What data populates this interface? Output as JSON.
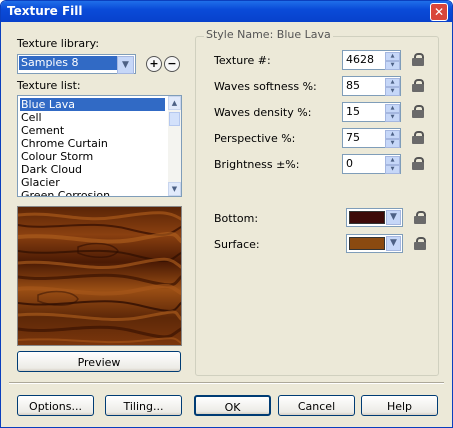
{
  "window": {
    "title": "Texture Fill",
    "close_glyph": "✕"
  },
  "library": {
    "label": "Texture library:",
    "selected": "Samples 8",
    "add_glyph": "+",
    "remove_glyph": "−"
  },
  "texture_list": {
    "label": "Texture list:",
    "items": [
      "Blue Lava",
      "Cell",
      "Cement",
      "Chrome Curtain",
      "Colour Storm",
      "Dark Cloud",
      "Glacier",
      "Green Corrosion"
    ],
    "selected_index": 0
  },
  "preview_button": "Preview",
  "style": {
    "title": "Style Name: Blue Lava",
    "params": [
      {
        "label": "Texture #:",
        "value": "4628"
      },
      {
        "label": "Waves softness %:",
        "value": "85"
      },
      {
        "label": "Waves density %:",
        "value": "15"
      },
      {
        "label": "Perspective %:",
        "value": "75"
      },
      {
        "label": "Brightness ±%:",
        "value": "0"
      }
    ],
    "colors": [
      {
        "label": "Bottom:",
        "value": "#3d0a08"
      },
      {
        "label": "Surface:",
        "value": "#8b4a10"
      }
    ]
  },
  "buttons": {
    "options": "Options...",
    "tiling": "Tiling...",
    "ok": "OK",
    "cancel": "Cancel",
    "help": "Help"
  }
}
